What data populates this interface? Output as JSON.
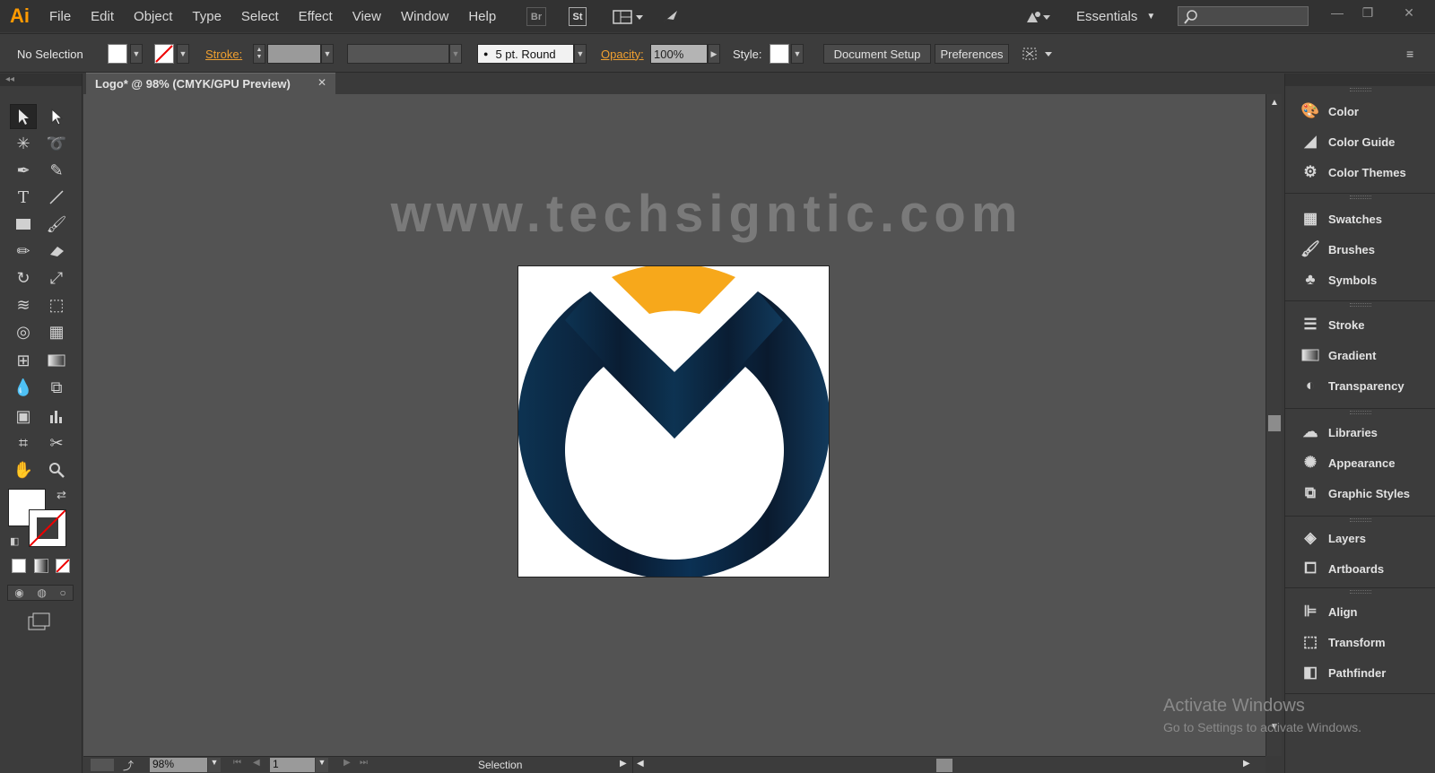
{
  "app": {
    "logo": "Ai",
    "accent": "#ff9a00"
  },
  "menu": [
    "File",
    "Edit",
    "Object",
    "Type",
    "Select",
    "Effect",
    "View",
    "Window",
    "Help"
  ],
  "menubar_right": {
    "bridge": "Br",
    "stock": "St",
    "workspace": "Essentials"
  },
  "control": {
    "selection": "No Selection",
    "stroke_label": "Stroke:",
    "brush": "5 pt. Round",
    "opacity_label": "Opacity:",
    "opacity_value": "100%",
    "style_label": "Style:",
    "doc_setup": "Document Setup",
    "preferences": "Preferences"
  },
  "document": {
    "tab_title": "Logo* @ 98% (CMYK/GPU Preview)",
    "watermark": "www.techsigntic.com",
    "logo_colors": {
      "navy": "#0d2f4f",
      "dark": "#0a1a2e",
      "orange": "#f7a81b"
    }
  },
  "status": {
    "zoom": "98%",
    "artboard": "1",
    "tool": "Selection"
  },
  "panels": [
    {
      "group": [
        {
          "label": "Color",
          "icon": "palette-icon"
        },
        {
          "label": "Color Guide",
          "icon": "color-guide-icon"
        },
        {
          "label": "Color Themes",
          "icon": "color-themes-icon"
        }
      ]
    },
    {
      "group": [
        {
          "label": "Swatches",
          "icon": "swatches-icon"
        },
        {
          "label": "Brushes",
          "icon": "brushes-icon"
        },
        {
          "label": "Symbols",
          "icon": "symbols-icon"
        }
      ]
    },
    {
      "group": [
        {
          "label": "Stroke",
          "icon": "stroke-icon"
        },
        {
          "label": "Gradient",
          "icon": "gradient-icon"
        },
        {
          "label": "Transparency",
          "icon": "transparency-icon"
        }
      ]
    },
    {
      "group": [
        {
          "label": "Libraries",
          "icon": "libraries-icon"
        },
        {
          "label": "Appearance",
          "icon": "appearance-icon"
        },
        {
          "label": "Graphic Styles",
          "icon": "graphic-styles-icon"
        }
      ]
    },
    {
      "group": [
        {
          "label": "Layers",
          "icon": "layers-icon"
        },
        {
          "label": "Artboards",
          "icon": "artboards-icon"
        }
      ]
    },
    {
      "group": [
        {
          "label": "Align",
          "icon": "align-icon"
        },
        {
          "label": "Transform",
          "icon": "transform-icon"
        },
        {
          "label": "Pathfinder",
          "icon": "pathfinder-icon"
        }
      ]
    }
  ],
  "windows_notice": {
    "title": "Activate Windows",
    "subtitle": "Go to Settings to activate Windows."
  }
}
